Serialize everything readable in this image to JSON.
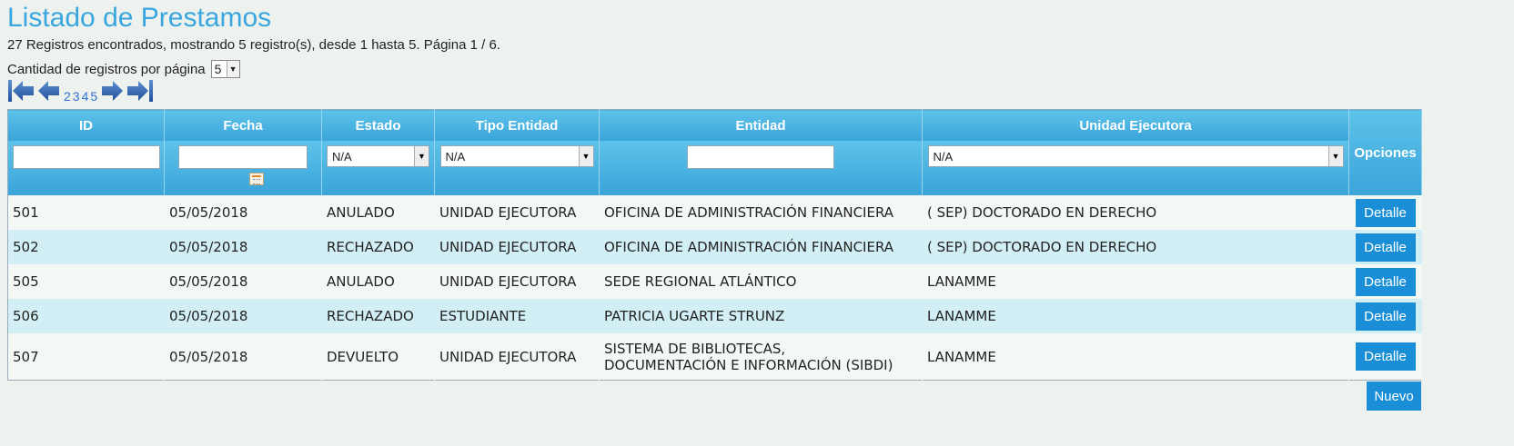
{
  "page": {
    "title": "Listado de Prestamos",
    "summary": "27 Registros encontrados, mostrando 5 registro(s), desde 1 hasta 5. Página 1 / 6."
  },
  "per_page": {
    "label": "Cantidad de registros por página",
    "value": "5"
  },
  "pager": {
    "pages": [
      "2",
      "3",
      "4",
      "5"
    ]
  },
  "table": {
    "headers": {
      "id": "ID",
      "fecha": "Fecha",
      "estado": "Estado",
      "tipo_entidad": "Tipo Entidad",
      "entidad": "Entidad",
      "unidad_ejecutora": "Unidad Ejecutora",
      "opciones": "Opciones"
    },
    "filters": {
      "estado": "N/A",
      "tipo_entidad": "N/A",
      "unidad_ejecutora": "N/A"
    },
    "rows": [
      {
        "id": "501",
        "fecha": "05/05/2018",
        "estado": "ANULADO",
        "tipo_entidad": "UNIDAD EJECUTORA",
        "entidad": "OFICINA DE ADMINISTRACIÓN FINANCIERA",
        "entidad2": "",
        "unidad_ejecutora": "( SEP) DOCTORADO EN DERECHO",
        "action": "Detalle"
      },
      {
        "id": "502",
        "fecha": "05/05/2018",
        "estado": "RECHAZADO",
        "tipo_entidad": "UNIDAD EJECUTORA",
        "entidad": "OFICINA DE ADMINISTRACIÓN FINANCIERA",
        "entidad2": "",
        "unidad_ejecutora": "( SEP) DOCTORADO EN DERECHO",
        "action": "Detalle"
      },
      {
        "id": "505",
        "fecha": "05/05/2018",
        "estado": "ANULADO",
        "tipo_entidad": "UNIDAD EJECUTORA",
        "entidad": "SEDE REGIONAL ATLÁNTICO",
        "entidad2": "",
        "unidad_ejecutora": "LANAMME",
        "action": "Detalle"
      },
      {
        "id": "506",
        "fecha": "05/05/2018",
        "estado": "RECHAZADO",
        "tipo_entidad": "ESTUDIANTE",
        "entidad": "PATRICIA UGARTE STRUNZ",
        "entidad2": "",
        "unidad_ejecutora": "LANAMME",
        "action": "Detalle"
      },
      {
        "id": "507",
        "fecha": "05/05/2018",
        "estado": "DEVUELTO",
        "tipo_entidad": "UNIDAD EJECUTORA",
        "entidad": "SISTEMA DE BIBLIOTECAS,",
        "entidad2": "DOCUMENTACIÓN E INFORMACIÓN (SIBDI)",
        "unidad_ejecutora": "LANAMME",
        "action": "Detalle"
      }
    ]
  },
  "new_button": "Nuevo",
  "colors": {
    "title": "#39a6df",
    "header": "#3aa4da",
    "button": "#1a8fd8",
    "row_alt": "#d1eff5"
  }
}
